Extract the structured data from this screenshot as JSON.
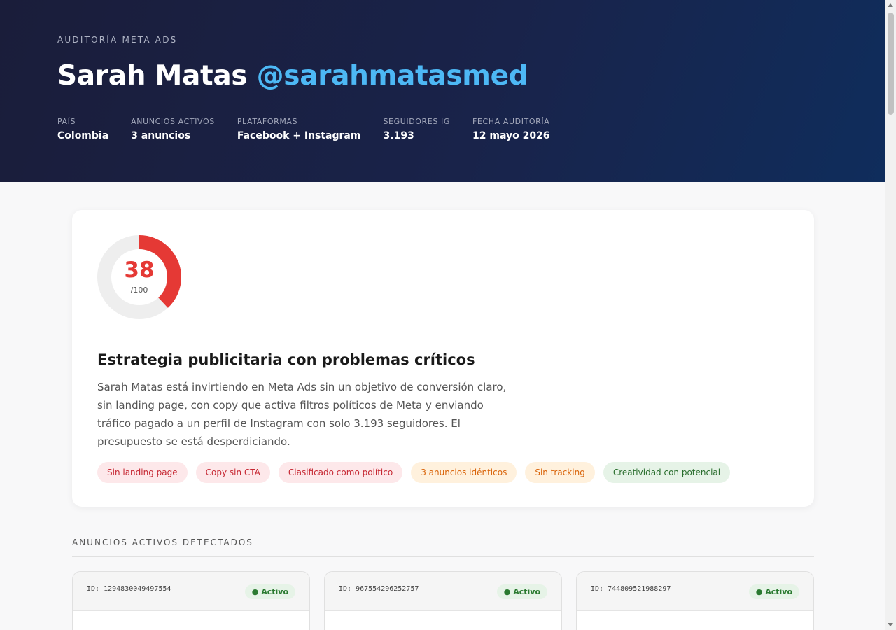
{
  "header": {
    "eyebrow": "AUDITORÍA META ADS",
    "name": "Sarah Matas",
    "handle": "@sarahmatasmed",
    "meta": [
      {
        "label": "PAÍS",
        "value": "Colombia"
      },
      {
        "label": "ANUNCIOS ACTIVOS",
        "value": "3 anuncios"
      },
      {
        "label": "PLATAFORMAS",
        "value": "Facebook + Instagram"
      },
      {
        "label": "SEGUIDORES IG",
        "value": "3.193"
      },
      {
        "label": "FECHA AUDITORÍA",
        "value": "12 mayo 2026"
      }
    ]
  },
  "score": {
    "value": "38",
    "max": "/100",
    "fraction": 0.38,
    "color": "#e53935",
    "track_color": "#eeeeee"
  },
  "summary": {
    "title": "Estrategia publicitaria con problemas críticos",
    "description": "Sarah Matas está invirtiendo en Meta Ads sin un objetivo de conversión claro, sin landing page, con copy que activa filtros políticos de Meta y enviando tráfico pagado a un perfil de Instagram con solo 3.193 seguidores. El presupuesto se está desperdiciando.",
    "tags": [
      {
        "label": "Sin landing page",
        "tone": "red"
      },
      {
        "label": "Copy sin CTA",
        "tone": "red"
      },
      {
        "label": "Clasificado como político",
        "tone": "red"
      },
      {
        "label": "3 anuncios idénticos",
        "tone": "orange"
      },
      {
        "label": "Sin tracking",
        "tone": "orange"
      },
      {
        "label": "Creatividad con potencial",
        "tone": "green"
      }
    ]
  },
  "ads_section": {
    "title": "ANUNCIOS ACTIVOS DETECTADOS",
    "ads": [
      {
        "id": "ID: 1294830049497554",
        "status": "● Activo"
      },
      {
        "id": "ID: 967554296252757",
        "status": "● Activo"
      },
      {
        "id": "ID: 744809521988297",
        "status": "● Activo"
      }
    ]
  }
}
